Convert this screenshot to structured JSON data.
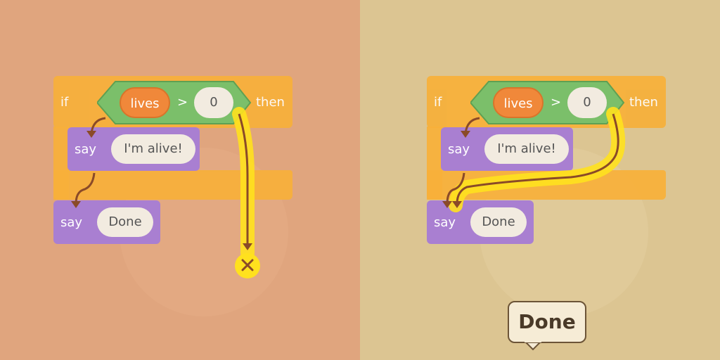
{
  "panels": [
    {
      "id": "left",
      "variant": "wrong",
      "if_keyword": "if",
      "then_keyword": "then",
      "condition": {
        "variable": "lives",
        "operator": ">",
        "value": "0"
      },
      "inner_say": {
        "keyword": "say",
        "text": "I'm alive!"
      },
      "after_say": {
        "keyword": "say",
        "text": "Done"
      },
      "dead_end_icon": "cross-icon"
    },
    {
      "id": "right",
      "variant": "correct",
      "if_keyword": "if",
      "then_keyword": "then",
      "condition": {
        "variable": "lives",
        "operator": ">",
        "value": "0"
      },
      "inner_say": {
        "keyword": "say",
        "text": "I'm alive!"
      },
      "after_say": {
        "keyword": "say",
        "text": "Done"
      },
      "speech_bubble": "Done"
    }
  ],
  "colors": {
    "left_bg": "#e0a57e",
    "right_bg": "#dcc592",
    "control": "#f7b03a",
    "operator": "#7bbf6a",
    "variable": "#f0883a",
    "looks": "#a97fd1",
    "pill": "#f2ebe0",
    "arrow": "#8a4a28",
    "highlight": "#ffe11e"
  }
}
